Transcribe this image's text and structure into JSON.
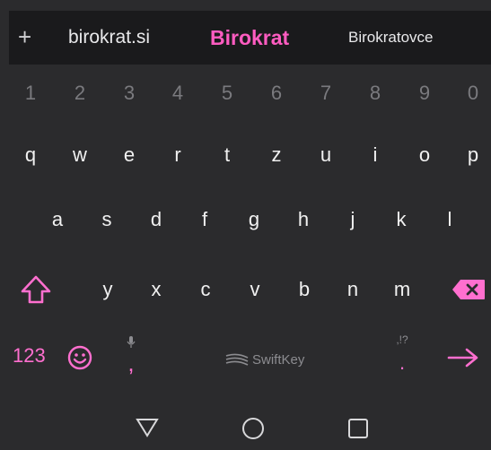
{
  "strip": {
    "left": "birokrat.si",
    "middle": "Birokrat",
    "right": "Birokratovce"
  },
  "number_row": [
    "1",
    "2",
    "3",
    "4",
    "5",
    "6",
    "7",
    "8",
    "9",
    "0"
  ],
  "row1": [
    "q",
    "w",
    "e",
    "r",
    "t",
    "z",
    "u",
    "i",
    "o",
    "p"
  ],
  "row2": [
    "a",
    "s",
    "d",
    "f",
    "g",
    "h",
    "j",
    "k",
    "l"
  ],
  "row3": [
    "y",
    "x",
    "c",
    "v",
    "b",
    "n",
    "m"
  ],
  "bottom": {
    "numbers_label": "123",
    "comma": ",",
    "space_brand": "SwiftKey",
    "period": ".",
    "period_alt": ",!?"
  },
  "colors": {
    "accent": "#ff6fcf",
    "background": "#2b2b2d",
    "strip": "#1a1a1c"
  },
  "icons": {
    "plus": "plus-icon",
    "shift": "shift-icon",
    "backspace": "backspace-icon",
    "emoji": "emoji-icon",
    "mic": "mic-icon",
    "enter": "enter-arrow-icon",
    "back": "nav-back-icon",
    "home": "nav-home-icon",
    "recents": "nav-recents-icon"
  }
}
